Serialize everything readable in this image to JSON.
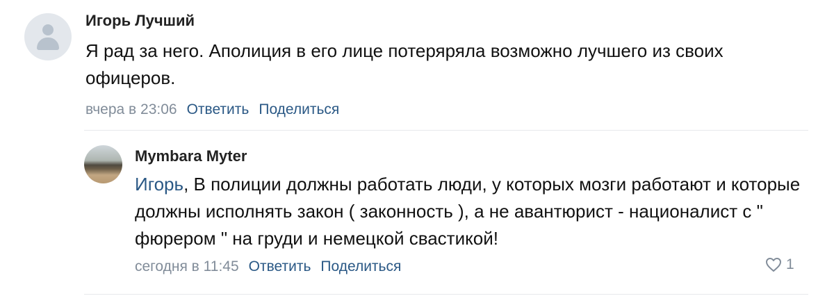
{
  "comment1": {
    "author": "Игорь Лучший",
    "text": "Я рад за него. Аполиция в его лице потеряряла возможно лучшего из своих офицеров.",
    "time": "вчера в 23:06",
    "reply_label": "Ответить",
    "share_label": "Поделиться"
  },
  "comment2": {
    "author": "Mymbara Myter",
    "mention": "Игорь",
    "text": ", В полиции должны работать люди, у которых мозги работают и которые должны исполнять закон ( законность ), а не авантюрист - националист с \" фюрером \" на груди и немецкой свастикой!",
    "time": "сегодня в 11:45",
    "reply_label": "Ответить",
    "share_label": "Поделиться",
    "likes": "1"
  },
  "colors": {
    "link": "#2a5885",
    "meta": "#818c99",
    "divider": "#e7e8ec"
  }
}
